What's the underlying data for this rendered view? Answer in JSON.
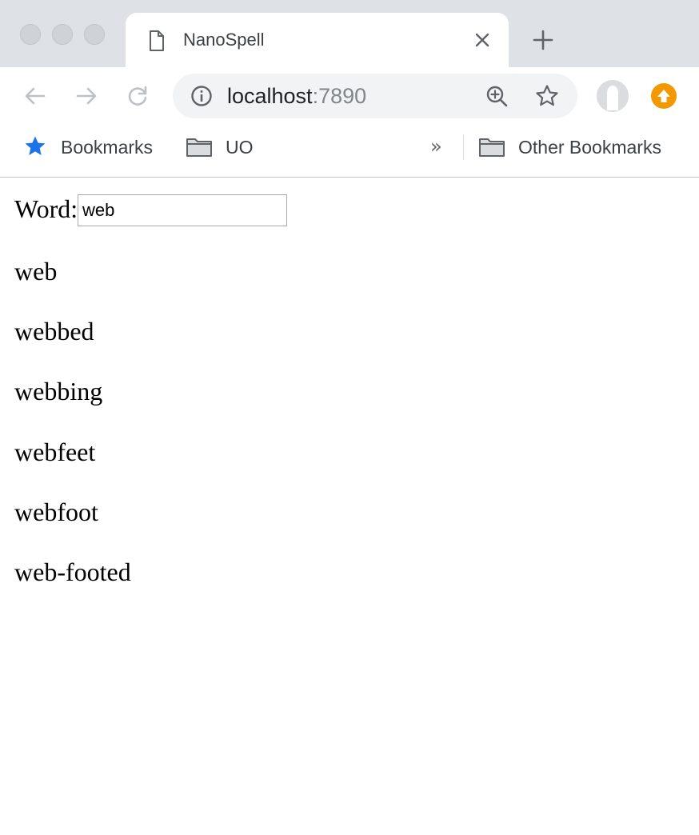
{
  "browser": {
    "tab": {
      "title": "NanoSpell"
    },
    "address_bar": {
      "host": "localhost",
      "port": ":7890"
    },
    "bookmarks_bar": {
      "items": [
        {
          "label": "Bookmarks",
          "icon": "star-icon"
        },
        {
          "label": "UO",
          "icon": "folder-icon"
        }
      ],
      "overflow_label": "»",
      "other_bookmarks_label": "Other Bookmarks"
    },
    "colors": {
      "tab_strip": "#dee1e6",
      "omnibox": "#f1f3f4",
      "bookmark_star": "#1a73e8",
      "update_badge": "#f29900"
    }
  },
  "page": {
    "word_label": "Word:",
    "word_input_value": "web",
    "results": [
      "web",
      "webbed",
      "webbing",
      "webfeet",
      "webfoot",
      "web-footed"
    ]
  }
}
